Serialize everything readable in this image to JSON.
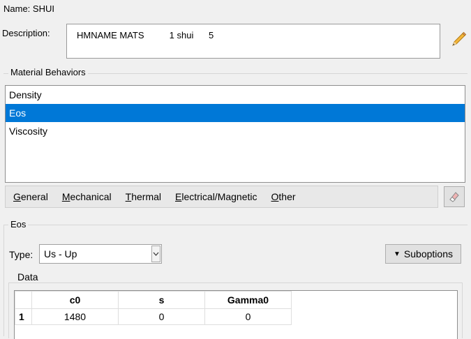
{
  "name": {
    "label": "Name:",
    "value": "SHUI"
  },
  "description": {
    "label": "Description:",
    "value": "HMNAME MATS          1 shui      5"
  },
  "material_behaviors": {
    "title": "Material Behaviors",
    "items": [
      {
        "label": "Density",
        "selected": false
      },
      {
        "label": "Eos",
        "selected": true
      },
      {
        "label": "Viscosity",
        "selected": false
      }
    ]
  },
  "menu": {
    "items": [
      {
        "mnemonic": "G",
        "rest": "eneral"
      },
      {
        "mnemonic": "M",
        "rest": "echanical"
      },
      {
        "mnemonic": "T",
        "rest": "hermal"
      },
      {
        "mnemonic": "E",
        "rest": "lectrical/Magnetic"
      },
      {
        "mnemonic": "O",
        "rest": "ther"
      }
    ]
  },
  "eos": {
    "title": "Eos",
    "type_label": "Type:",
    "type_value": "Us - Up",
    "suboptions_label": "Suboptions",
    "data": {
      "title": "Data",
      "columns": [
        "c0",
        "s",
        "Gamma0"
      ],
      "rows": [
        {
          "index": "1",
          "values": [
            "1480",
            "0",
            "0"
          ]
        }
      ]
    }
  },
  "colors": {
    "selection": "#0078d7",
    "background": "#f0f0f0"
  },
  "icons": {
    "edit": "pencil-icon",
    "erase": "eraser-icon",
    "dropdown": "chevron-down-icon"
  }
}
